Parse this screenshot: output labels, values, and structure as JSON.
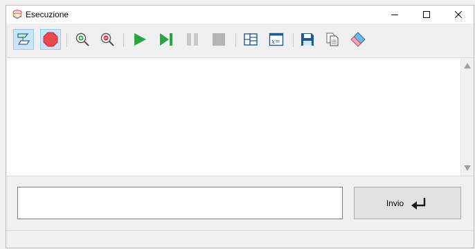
{
  "window": {
    "title": "Esecuzione",
    "controls": [
      "minimize-icon",
      "maximize-icon",
      "close-icon"
    ]
  },
  "toolbar": {
    "groups": [
      [
        "flowchart-shape-icon",
        "stop-octagon-icon"
      ],
      [
        "zoom-in-icon",
        "zoom-out-icon"
      ],
      [
        "play-icon",
        "step-forward-icon",
        "pause-icon",
        "stop-icon"
      ],
      [
        "layout-panels-icon",
        "variables-x-equals-icon"
      ],
      [
        "save-floppy-icon",
        "copy-document-icon",
        "eraser-icon"
      ]
    ],
    "variables_glyph": "x=",
    "colors": {
      "accent": "#1e7fc9",
      "stop": "#e8494f",
      "play": "#25a844",
      "disabled": "#b4b4b4"
    }
  },
  "output": {
    "text": ""
  },
  "input": {
    "value": "",
    "placeholder": ""
  },
  "send_button": {
    "label": "Invio",
    "icon": "enter-return-icon"
  },
  "statusbar": {
    "text": ""
  }
}
